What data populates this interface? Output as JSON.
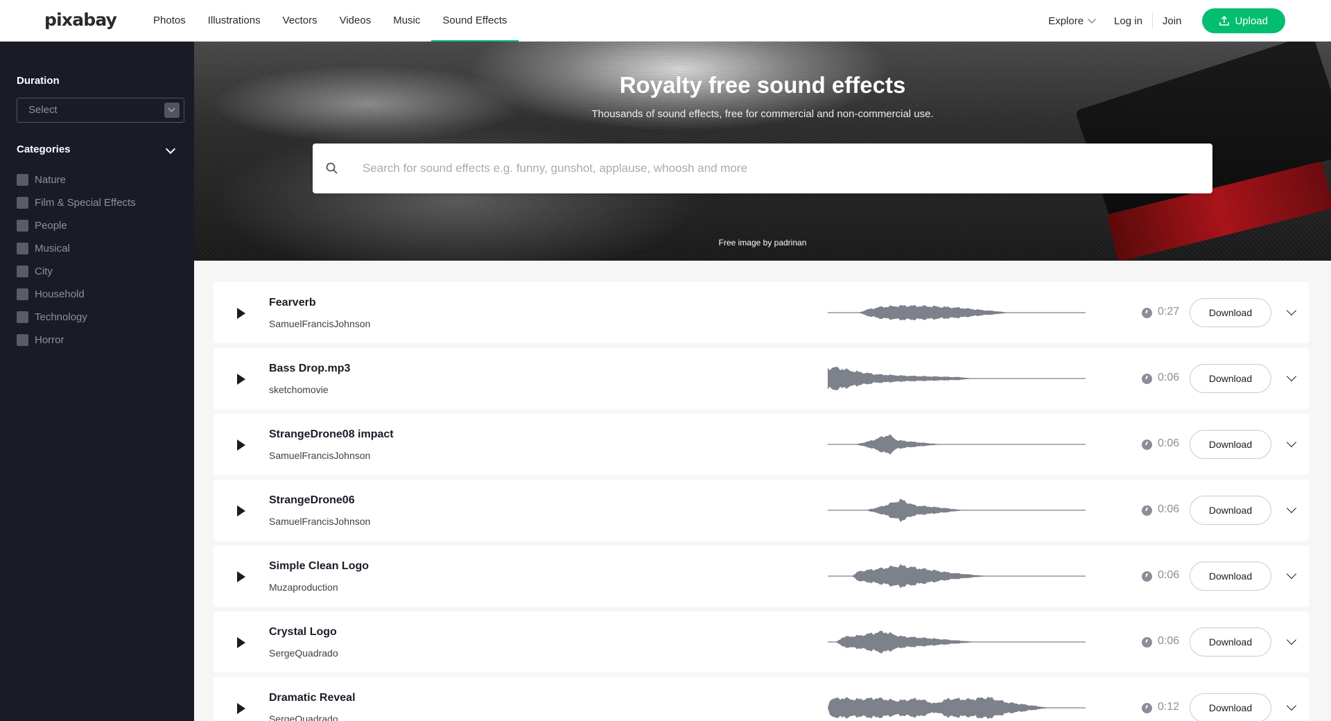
{
  "header": {
    "logo": "pixabay",
    "nav": [
      "Photos",
      "Illustrations",
      "Vectors",
      "Videos",
      "Music",
      "Sound Effects"
    ],
    "active_nav": "Sound Effects",
    "explore": "Explore",
    "login": "Log in",
    "join": "Join",
    "upload": "Upload",
    "accent_color": "#02be6e"
  },
  "sidebar": {
    "duration_title": "Duration",
    "duration_select": "Select",
    "categories_title": "Categories",
    "categories": [
      "Nature",
      "Film & Special Effects",
      "People",
      "Musical",
      "City",
      "Household",
      "Technology",
      "Horror"
    ]
  },
  "hero": {
    "title": "Royalty free sound effects",
    "subtitle": "Thousands of sound effects, free for commercial and non-commercial use.",
    "search_placeholder": "Search for sound effects e.g. funny, gunshot, applause, whoosh and more",
    "credit": "Free image by padrinan"
  },
  "tracks": [
    {
      "title": "Fearverb",
      "author": "SamuelFrancisJohnson",
      "duration": "0:27",
      "download": "Download"
    },
    {
      "title": "Bass Drop.mp3",
      "author": "sketchomovie",
      "duration": "0:06",
      "download": "Download"
    },
    {
      "title": "StrangeDrone08 impact",
      "author": "SamuelFrancisJohnson",
      "duration": "0:06",
      "download": "Download"
    },
    {
      "title": "StrangeDrone06",
      "author": "SamuelFrancisJohnson",
      "duration": "0:06",
      "download": "Download"
    },
    {
      "title": "Simple Clean Logo",
      "author": "Muzaproduction",
      "duration": "0:06",
      "download": "Download"
    },
    {
      "title": "Crystal Logo",
      "author": "SergeQuadrado",
      "duration": "0:06",
      "download": "Download"
    },
    {
      "title": "Dramatic Reveal",
      "author": "SergeQuadrado",
      "duration": "0:12",
      "download": "Download"
    }
  ],
  "icons": {
    "search": "search-icon",
    "upload": "upload-icon",
    "play": "play-icon",
    "duration": "clock-icon",
    "expand": "chevron-down-icon"
  },
  "colors": {
    "sidebar_bg": "#191b26",
    "waveform": "#7d818c",
    "page_bg": "#f6f6f7"
  }
}
